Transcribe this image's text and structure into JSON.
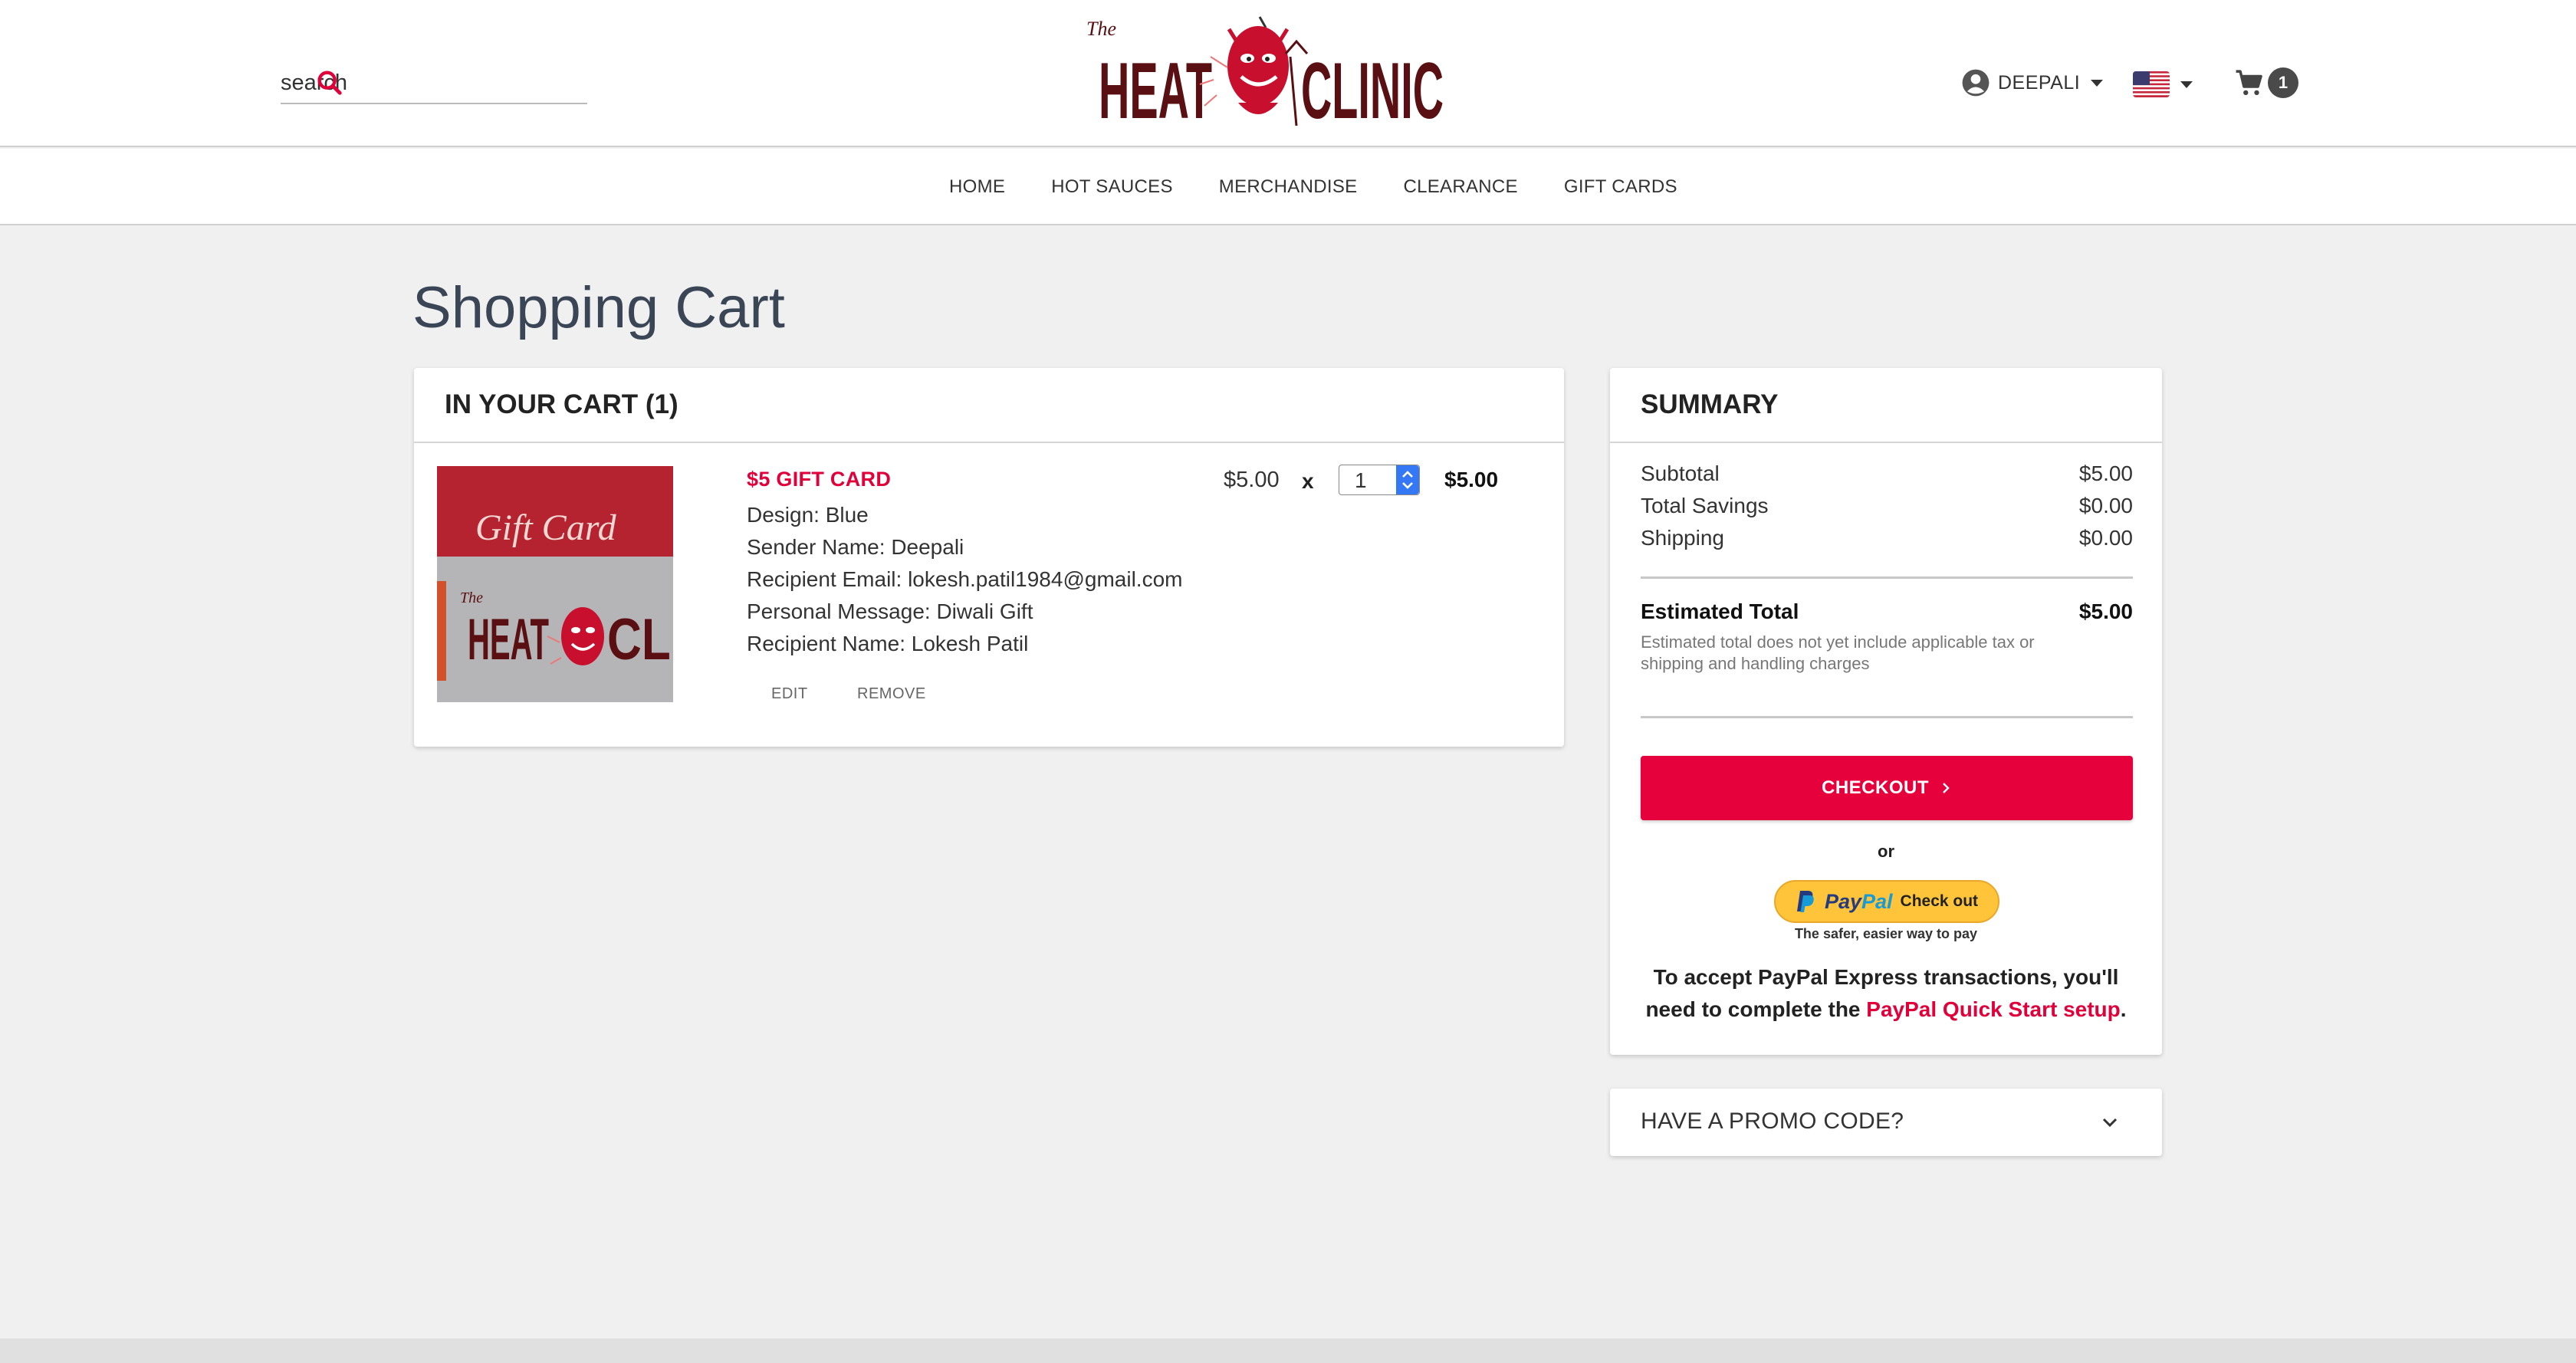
{
  "header": {
    "search": {
      "placeholder": "search",
      "value": ""
    },
    "logo": {
      "the": "The",
      "heat": "HEAT",
      "clinic": "CLINIC"
    },
    "user": {
      "name": "DEEPALI"
    },
    "cart": {
      "count": "1"
    }
  },
  "nav": {
    "items": [
      {
        "label": "HOME"
      },
      {
        "label": "HOT SAUCES"
      },
      {
        "label": "MERCHANDISE"
      },
      {
        "label": "CLEARANCE"
      },
      {
        "label": "GIFT CARDS"
      }
    ]
  },
  "page": {
    "title": "Shopping Cart"
  },
  "cart": {
    "heading": "IN YOUR CART (1)",
    "item": {
      "image_text": {
        "gift_card": "Gift Card",
        "the": "The",
        "heat": "HEAT",
        "clinic": "CLI"
      },
      "name": "$5 GIFT CARD",
      "attributes": [
        "Design: Blue",
        "Sender Name: Deepali",
        "Recipient Email: lokesh.patil1984@gmail.com",
        "Personal Message: Diwali Gift",
        "Recipient Name: Lokesh Patil"
      ],
      "unit_price": "$5.00",
      "times": "x",
      "quantity": "1",
      "line_total": "$5.00",
      "edit_label": "EDIT",
      "remove_label": "REMOVE"
    }
  },
  "summary": {
    "heading": "SUMMARY",
    "rows": [
      {
        "label": "Subtotal",
        "value": "$5.00"
      },
      {
        "label": "Total Savings",
        "value": "$0.00"
      },
      {
        "label": "Shipping",
        "value": "$0.00"
      }
    ],
    "estimated_label": "Estimated Total",
    "estimated_value": "$5.00",
    "estimated_note": "Estimated total does not yet include applicable tax or shipping and handling charges",
    "checkout_label": "CHECKOUT",
    "or_label": "or",
    "paypal": {
      "brand_a": "Pay",
      "brand_b": "Pal",
      "button_text": "Check out",
      "tagline": "The safer, easier way to pay",
      "note_prefix": "To accept PayPal Express transactions, you'll need to complete the ",
      "note_link": "PayPal Quick Start setup",
      "note_suffix": "."
    }
  },
  "promo": {
    "label": "HAVE A PROMO CODE?"
  },
  "colors": {
    "accent": "#e6003c",
    "brand": "#5a0f12",
    "paypal_yellow": "#ffc439"
  },
  "icons": {
    "search": "search-icon",
    "user": "account-circle-icon",
    "flag": "us-flag-icon",
    "cart": "cart-icon",
    "checkout": "chevron-right-icon",
    "promo": "chevron-down-icon"
  }
}
